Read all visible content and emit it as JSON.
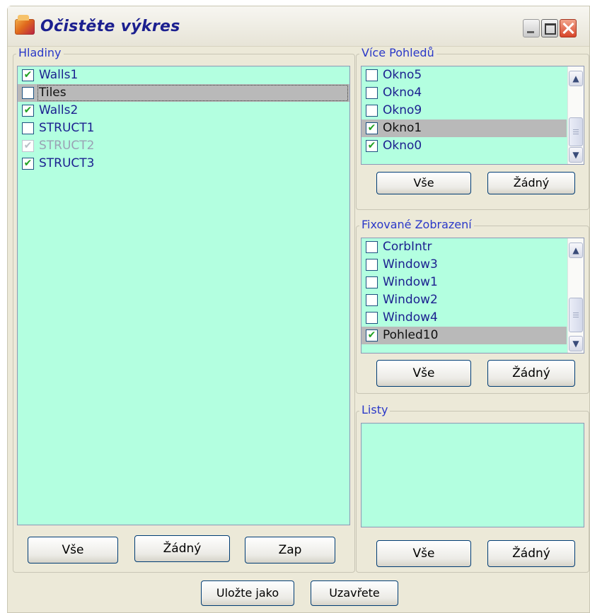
{
  "window": {
    "title": "Očistěte výkres"
  },
  "groups": {
    "layers": {
      "legend": "Hladiny",
      "items": [
        {
          "label": "Walls1",
          "checked": true,
          "state": ""
        },
        {
          "label": "Tiles",
          "checked": false,
          "state": "selected focused"
        },
        {
          "label": "Walls2",
          "checked": true,
          "state": ""
        },
        {
          "label": "STRUCT1",
          "checked": false,
          "state": ""
        },
        {
          "label": "STRUCT2",
          "checked": true,
          "state": "disabled"
        },
        {
          "label": "STRUCT3",
          "checked": true,
          "state": ""
        }
      ],
      "buttons": {
        "all": "Vše",
        "none": "Žádný",
        "on": "Zap"
      }
    },
    "views": {
      "legend": "Více Pohledů",
      "items": [
        {
          "label": "Okno5",
          "checked": false,
          "state": ""
        },
        {
          "label": "Okno4",
          "checked": false,
          "state": ""
        },
        {
          "label": "Okno9",
          "checked": false,
          "state": ""
        },
        {
          "label": "Okno1",
          "checked": true,
          "state": "selected"
        },
        {
          "label": "Okno0",
          "checked": true,
          "state": ""
        }
      ],
      "buttons": {
        "all": "Vše",
        "none": "Žádný"
      }
    },
    "fixed": {
      "legend": "Fixované Zobrazení",
      "items": [
        {
          "label": "CorbIntr",
          "checked": false,
          "state": ""
        },
        {
          "label": "Window3",
          "checked": false,
          "state": ""
        },
        {
          "label": "Window1",
          "checked": false,
          "state": ""
        },
        {
          "label": "Window2",
          "checked": false,
          "state": ""
        },
        {
          "label": "Window4",
          "checked": false,
          "state": ""
        },
        {
          "label": "Pohled10",
          "checked": true,
          "state": "selected"
        }
      ],
      "buttons": {
        "all": "Vše",
        "none": "Žádný"
      }
    },
    "sheets": {
      "legend": "Listy",
      "items": [],
      "buttons": {
        "all": "Vše",
        "none": "Žádný"
      }
    }
  },
  "footer": {
    "save_as": "Uložte jako",
    "close": "Uzavřete"
  },
  "colors": {
    "list_bg": "#b3ffe0",
    "window_bg": "#ece9d8",
    "text": "#1b1f8f",
    "legend": "#2a38c8",
    "selection": "#b9b9b9"
  },
  "icons": {
    "app": "app-folder-icon",
    "check": "checkmark-icon",
    "scroll_up": "chevron-up-icon",
    "scroll_down": "chevron-down-icon"
  }
}
